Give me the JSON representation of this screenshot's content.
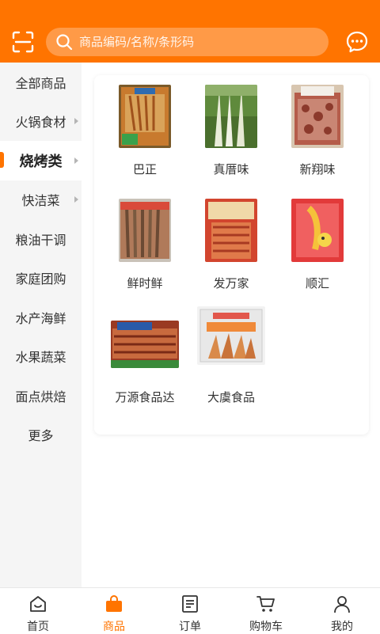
{
  "header": {
    "search_placeholder": "商品编码/名称/条形码",
    "scan_icon": "scan-icon",
    "message_icon": "chat-bubble-icon",
    "accent_color": "#ff7400"
  },
  "sidebar": {
    "items": [
      {
        "label": "全部商品",
        "has_arrow": false,
        "active": false
      },
      {
        "label": "火锅食材",
        "has_arrow": true,
        "active": false
      },
      {
        "label": "烧烤类",
        "has_arrow": true,
        "active": true
      },
      {
        "label": "快洁菜",
        "has_arrow": true,
        "active": false
      },
      {
        "label": "粮油干调",
        "has_arrow": false,
        "active": false
      },
      {
        "label": "家庭团购",
        "has_arrow": false,
        "active": false
      },
      {
        "label": "水产海鲜",
        "has_arrow": false,
        "active": false
      },
      {
        "label": "水果蔬菜",
        "has_arrow": false,
        "active": false
      },
      {
        "label": "面点烘焙",
        "has_arrow": false,
        "active": false
      },
      {
        "label": "更多",
        "has_arrow": false,
        "active": false
      }
    ]
  },
  "brands": [
    {
      "name": "巴正"
    },
    {
      "name": "真厝味"
    },
    {
      "name": "新翔味"
    },
    {
      "name": "鲜时鲜"
    },
    {
      "name": "发万家"
    },
    {
      "name": "顺汇"
    },
    {
      "name": "万源食品达"
    },
    {
      "name": "大虞食品"
    }
  ],
  "tabbar": {
    "tabs": [
      {
        "label": "首页",
        "icon": "home-icon",
        "active": false
      },
      {
        "label": "商品",
        "icon": "shopping-bag-icon",
        "active": true
      },
      {
        "label": "订单",
        "icon": "order-list-icon",
        "active": false
      },
      {
        "label": "购物车",
        "icon": "cart-icon",
        "active": false
      },
      {
        "label": "我的",
        "icon": "user-icon",
        "active": false
      }
    ]
  }
}
